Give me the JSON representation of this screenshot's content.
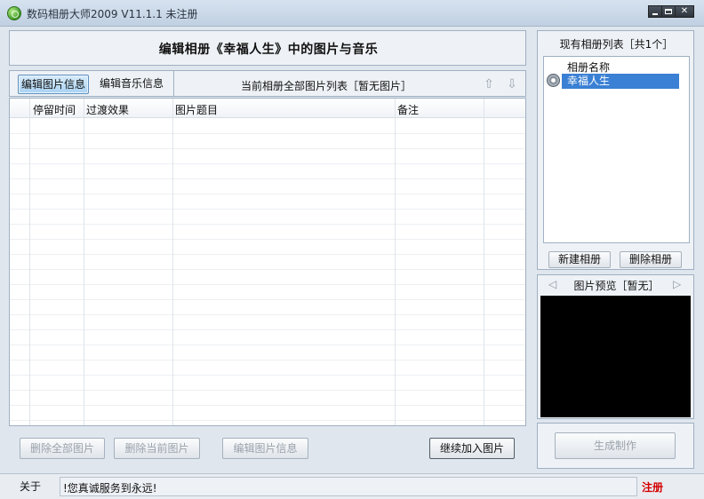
{
  "window": {
    "title": "数码相册大师2009  V11.1.1  未注册",
    "btn_min": "",
    "btn_max": "",
    "btn_close": "✕"
  },
  "main": {
    "title": "编辑相册《幸福人生》中的图片与音乐",
    "tabs": [
      {
        "label": "编辑图片信息",
        "active": true
      },
      {
        "label": "编辑音乐信息",
        "active": false
      }
    ],
    "list_caption": "当前相册全部图片列表［暂无图片］",
    "arrow_up": "⇧",
    "arrow_down": "⇩",
    "columns": [
      "停留时间",
      "过渡效果",
      "图片题目",
      "备注"
    ],
    "rows": []
  },
  "buttons": {
    "delete_all": "删除全部图片",
    "delete_current": "删除当前图片",
    "edit_info": "编辑图片信息",
    "continue_add": "继续加入图片"
  },
  "albums": {
    "header": "现有相册列表［共1个］",
    "column": "相册名称",
    "items": [
      "幸福人生"
    ],
    "new_button": "新建相册",
    "delete_button": "删除相册"
  },
  "preview": {
    "header": "图片预览［暂无］",
    "prev": "◁",
    "next": "▷"
  },
  "generate": {
    "button": "生成制作"
  },
  "status": {
    "about": "关于",
    "message": "!您真诚服务到永远!",
    "register": "注册"
  },
  "colors": {
    "accent": "#3a80d4",
    "register_red": "#d40000",
    "preview_bg": "#000000"
  }
}
